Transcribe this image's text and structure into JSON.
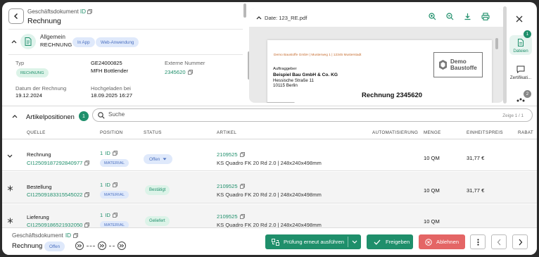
{
  "header": {
    "doc_type": "Geschäftsdokument",
    "id_label": "ID",
    "title": "Rechnung"
  },
  "general": {
    "title": "Allgemein",
    "subtitle": "RECHNUNG",
    "tags": [
      "In App",
      "Web-Anwendung"
    ],
    "fields": {
      "typ_label": "Typ",
      "typ_value": "RECHNUNG",
      "number_value": "GE24000825",
      "supplier_value": "MFH Bottlender",
      "ext_label": "Externe Nummer",
      "ext_value": "2345620",
      "date_label": "Datum der Rechnung",
      "date_value": "19.12.2024",
      "upload_label": "Hochgeladen bei",
      "upload_value": "18.09.2025 16:27"
    }
  },
  "pdf": {
    "date_label": "Date: 123_RE.pdf",
    "sender_line": "Demo Baustoffe GmbH | Musterweg 1 | 12345 Musterstadt",
    "logo_line1": "Demo",
    "logo_line2": "Baustoffe",
    "recipient_header": "Auftraggeber",
    "recipient_name": "Beispiel Bau GmbH & Co. KG",
    "recipient_street": "Hessische Straße 11",
    "recipient_city": "10115 Berlin",
    "invoice_title": "Rechnung 2345620"
  },
  "rail": {
    "files_label": "Dateien",
    "files_badge": "1",
    "cert_label": "Zertifikati...",
    "third_badge": "2"
  },
  "list": {
    "title": "Artikelpositionen",
    "count": "1",
    "search_placeholder": "Suche",
    "shown": "Zeige 1 / 1",
    "columns": [
      "QUELLE",
      "POSITION",
      "STATUS",
      "ARTIKEL",
      "AUTOMATISIERUNG",
      "MENGE",
      "EINHEITSPREIS",
      "RABAT"
    ],
    "rows": [
      {
        "source": "Rechnung",
        "source_id": "CI12509187292840977",
        "position": "1",
        "id_label": "ID",
        "material": "MATERIAL",
        "status": "Offen",
        "article_no": "2109525",
        "article_desc": "KS Quadro FK 20 Rd 2.0 | 248x240x498mm",
        "qty": "10 QM",
        "price": "31,77 €"
      },
      {
        "source": "Bestellung",
        "source_id": "CI12509183315545022",
        "position": "1",
        "id_label": "ID",
        "material": "MATERIAL",
        "status": "Bestätigt",
        "article_no": "2109525",
        "article_desc": "KS Quadro FK 20 Rd 2.0 | 248x240x498mm",
        "qty": "10 QM",
        "price": "31,77 €"
      },
      {
        "source": "Lieferung",
        "source_id": "CI12509186521932050",
        "position": "1",
        "id_label": "ID",
        "material": "MATERIAL",
        "status": "Geliefert",
        "article_no": "2109525",
        "article_desc": "KS Quadro FK 20 Rd 2.0 | 248x240x498mm",
        "qty": "10 QM",
        "price": ""
      }
    ]
  },
  "footer": {
    "doc_type": "Geschäftsdokument",
    "id_label": "ID",
    "title": "Rechnung",
    "status": "Offen",
    "recheck_label": "Prüfung erneut ausführen",
    "approve_label": "Freigeben",
    "reject_label": "Ablehnen"
  },
  "colors": {
    "accent": "#1f8f6b",
    "danger": "#e46565",
    "tag_blue": "#dfe9fb"
  }
}
